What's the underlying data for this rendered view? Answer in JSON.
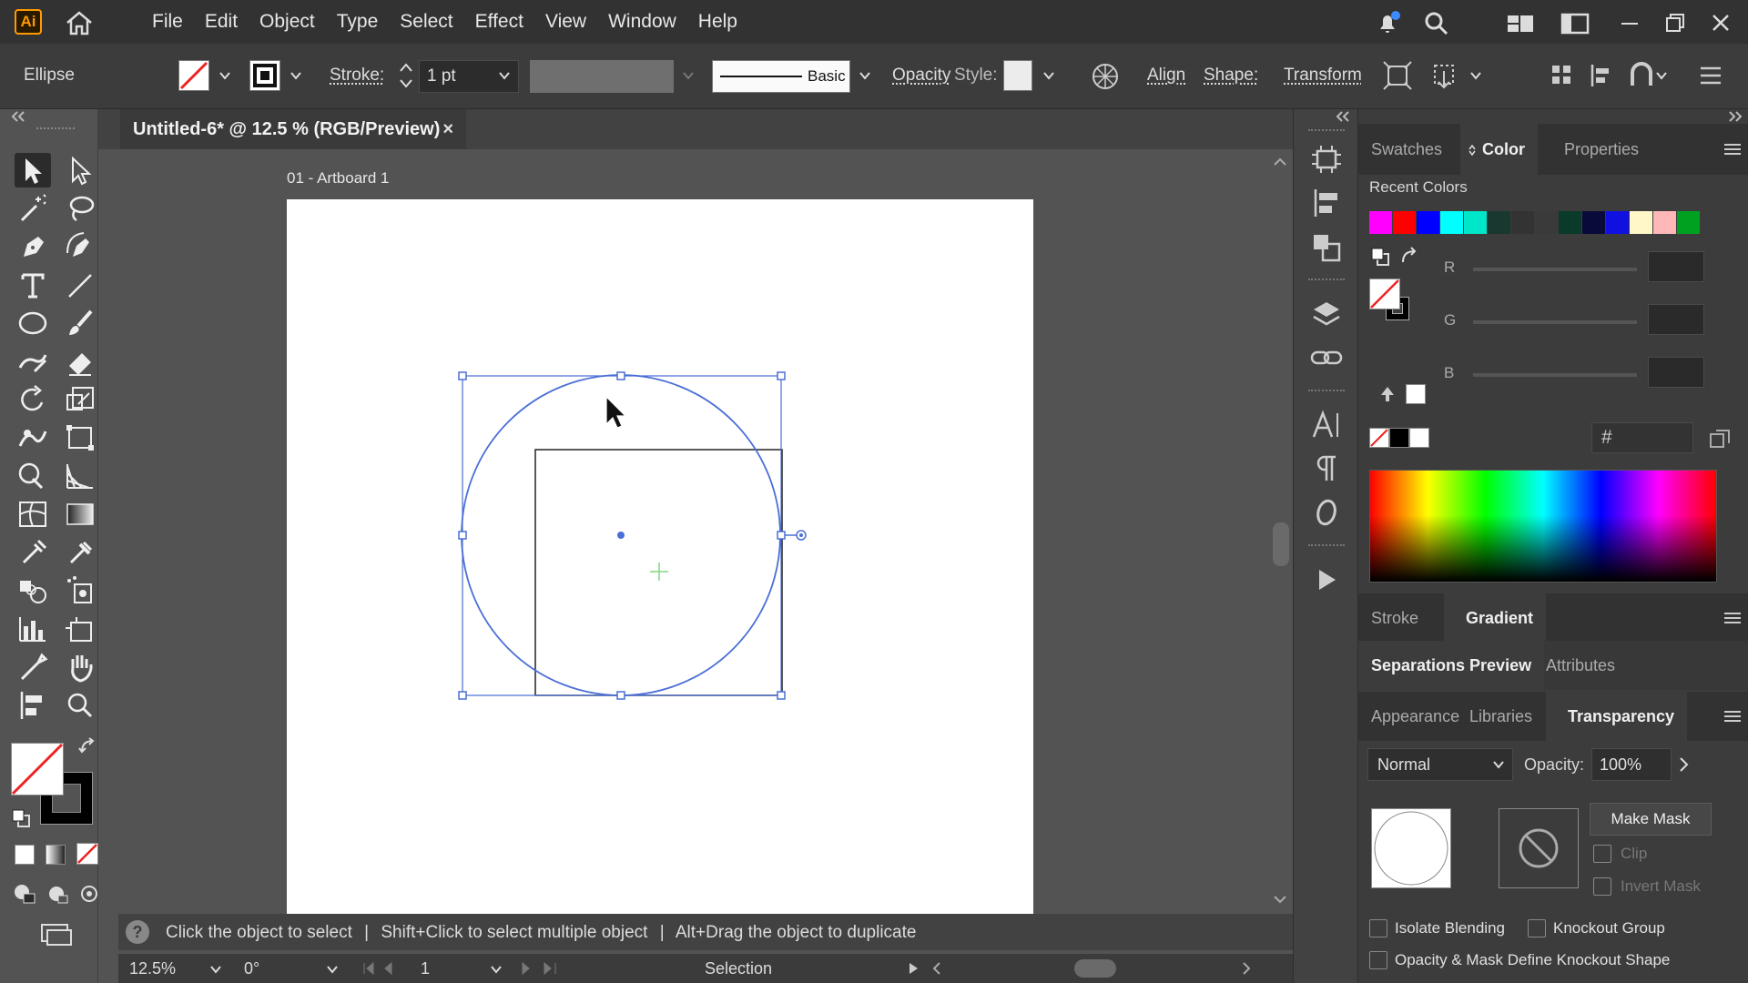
{
  "app": {
    "logo_text": "Ai",
    "menus": [
      "File",
      "Edit",
      "Object",
      "Type",
      "Select",
      "Effect",
      "View",
      "Window",
      "Help"
    ]
  },
  "control_bar": {
    "selection_label": "Ellipse",
    "stroke_label": "Stroke:",
    "stroke_weight": "1 pt",
    "brush_label": "Basic",
    "opacity_label": "Opacity",
    "style_label": "Style:",
    "align_label": "Align",
    "shape_label": "Shape:",
    "transform_label": "Transform"
  },
  "document": {
    "tab_title": "Untitled-6* @ 12.5 % (RGB/Preview)",
    "close_glyph": "×",
    "artboard_label": "01 - Artboard 1"
  },
  "status": {
    "help_glyph": "?",
    "hint_1": "Click the object to select",
    "sep": "|",
    "hint_2": "Shift+Click to select multiple object",
    "hint_3": "Alt+Drag the object to duplicate",
    "zoom": "12.5%",
    "rotation": "0°",
    "artboard_number": "1",
    "tool_name": "Selection"
  },
  "color_panel": {
    "tabs": [
      "Swatches",
      "Color",
      "Properties"
    ],
    "recent_colors_label": "Recent Colors",
    "recent_colors": [
      "#ff00ff",
      "#ff0000",
      "#0000ff",
      "#00ffff",
      "#00e6c8",
      "#183830",
      "#333333",
      "#3a3a3a",
      "#0a3a2a",
      "#0a0a3a",
      "#1010e0",
      "#fff7c8",
      "#ffb8b8",
      "#00a020"
    ],
    "channels": [
      "R",
      "G",
      "B"
    ],
    "hex_symbol": "#"
  },
  "gradient_panel": {
    "tabs": [
      "Stroke",
      "Gradient"
    ]
  },
  "sep_panel": {
    "tabs": [
      "Separations Preview",
      "Attributes"
    ]
  },
  "transparency_panel": {
    "tabs": [
      "Appearance",
      "Libraries",
      "Transparency"
    ],
    "blend_mode": "Normal",
    "opacity_label": "Opacity:",
    "opacity_value": "100%",
    "make_mask": "Make Mask",
    "clip": "Clip",
    "invert_mask": "Invert Mask",
    "isolate_blending": "Isolate Blending",
    "knockout_group": "Knockout Group",
    "opacity_mask_knockout": "Opacity & Mask Define Knockout Shape"
  },
  "colors": {
    "selection_blue": "#4a6fd6",
    "accent_orange": "#ff9a00",
    "notification_dot": "#3d8bff"
  }
}
